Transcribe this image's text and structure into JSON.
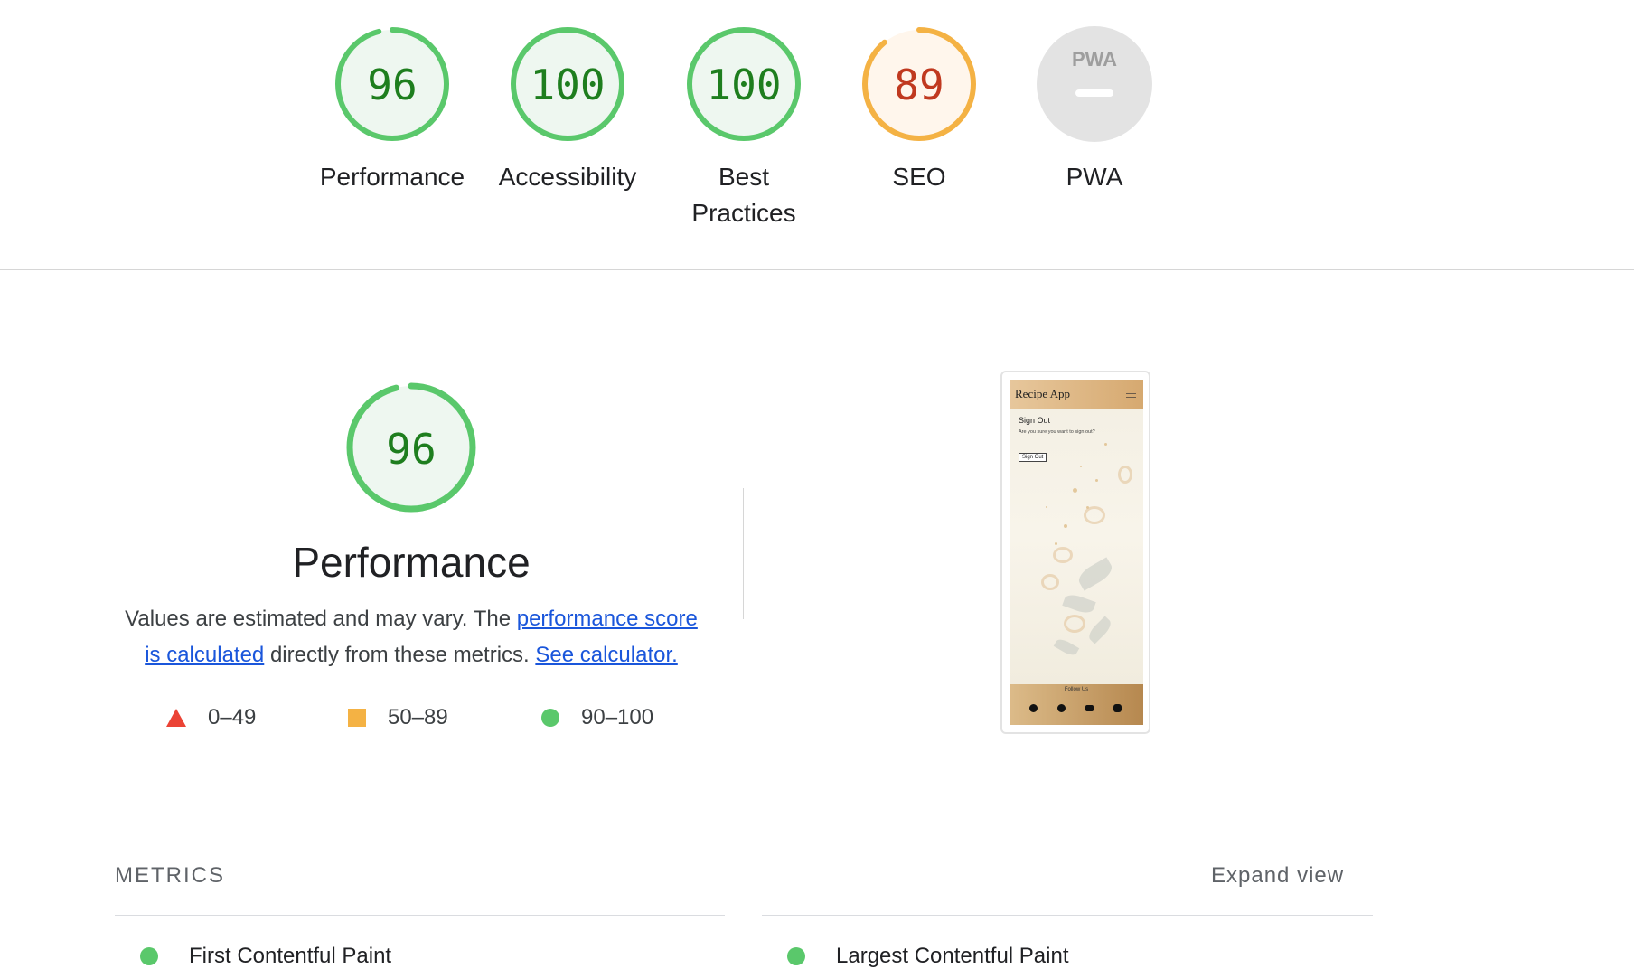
{
  "categories": [
    {
      "score": "96",
      "score_value": 96,
      "label": "Performance",
      "status": "pass"
    },
    {
      "score": "100",
      "score_value": 100,
      "label": "Accessibility",
      "status": "pass"
    },
    {
      "score": "100",
      "score_value": 100,
      "label": "Best Practices",
      "status": "pass"
    },
    {
      "score": "89",
      "score_value": 89,
      "label": "SEO",
      "status": "average"
    },
    {
      "score": "",
      "score_value": null,
      "label": "PWA",
      "status": "na",
      "badge_text": "PWA"
    }
  ],
  "colors": {
    "pass_ring": "#5ac86b",
    "pass_fill": "#eef7f0",
    "pass_text": "#1e7e1e",
    "avg_ring": "#f4b244",
    "avg_fill": "#fff6ec",
    "avg_text": "#c0391f",
    "na_fill": "#e3e3e3",
    "na_text": "#9e9e9e",
    "link": "#1a56db",
    "fail": "#eb4335"
  },
  "performance": {
    "score": "96",
    "score_value": 96,
    "title": "Performance",
    "desc_prefix": "Values are estimated and may vary. The",
    "link_score": "performance score is calculated",
    "desc_mid": "directly from these metrics.",
    "link_calc": "See calculator.",
    "legend": [
      {
        "icon": "triangle",
        "range": "0–49"
      },
      {
        "icon": "square",
        "range": "50–89"
      },
      {
        "icon": "circle",
        "range": "90–100"
      }
    ]
  },
  "screenshot": {
    "app_title": "Recipe App",
    "heading": "Sign Out",
    "text": "Are you sure you want to sign out?",
    "button": "Sign Out",
    "footer": "Follow Us",
    "social_icons": [
      "twitter-icon",
      "facebook-icon",
      "youtube-icon",
      "instagram-icon"
    ]
  },
  "metrics": {
    "heading": "METRICS",
    "expand": "Expand view",
    "items": [
      {
        "name": "First Contentful Paint",
        "status": "pass"
      },
      {
        "name": "Largest Contentful Paint",
        "status": "pass"
      }
    ]
  }
}
